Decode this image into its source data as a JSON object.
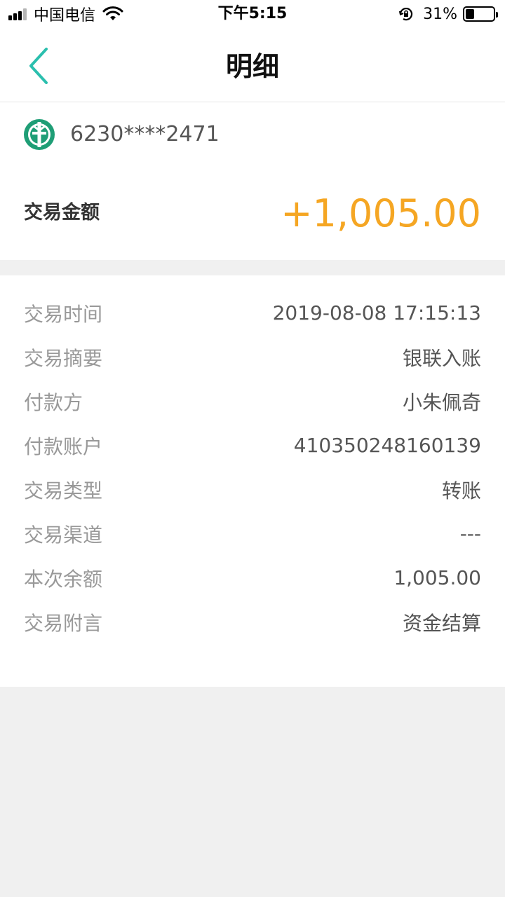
{
  "status_bar": {
    "carrier": "中国电信",
    "time": "下午5:15",
    "battery_percent": "31%",
    "battery_level": 0.31,
    "icons": [
      "signal-icon",
      "wifi-icon",
      "rotation-lock-icon",
      "battery-icon"
    ]
  },
  "nav": {
    "title": "明细",
    "back_icon": "chevron-left-icon"
  },
  "summary": {
    "bank_icon": "abc-bank-logo",
    "card_number": "6230****2471",
    "amount_label": "交易金额",
    "amount_value": "+1,005.00"
  },
  "details": [
    {
      "label": "交易时间",
      "value": "2019-08-08 17:15:13"
    },
    {
      "label": "交易摘要",
      "value": "银联入账"
    },
    {
      "label": "付款方",
      "value": "小朱佩奇"
    },
    {
      "label": "付款账户",
      "value": "410350248160139"
    },
    {
      "label": "交易类型",
      "value": "转账"
    },
    {
      "label": "交易渠道",
      "value": "---"
    },
    {
      "label": "本次余额",
      "value": "1,005.00"
    },
    {
      "label": "交易附言",
      "value": "资金结算"
    }
  ],
  "colors": {
    "accent": "#2bbfae",
    "amount": "#f5a623",
    "bank_green": "#1f9e76"
  }
}
